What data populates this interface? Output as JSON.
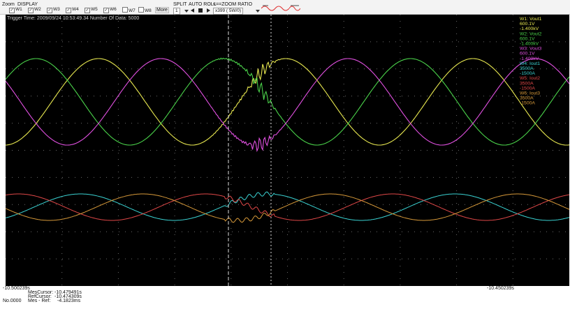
{
  "toolbar": {
    "zoom_label": "Zoom",
    "display_label": "DISPLAY",
    "split_label": "SPLIT",
    "auto_roll_label": "AUTO ROLL",
    "zoom_ratio_label": "<==ZOOM RATIO",
    "split_value": "1",
    "ratio_value": "x399 ( 5W/0)",
    "more_label": "More",
    "channels": [
      {
        "label": "W1",
        "checked": true
      },
      {
        "label": "W2",
        "checked": true
      },
      {
        "label": "W3",
        "checked": true
      },
      {
        "label": "W4",
        "checked": true
      },
      {
        "label": "W5",
        "checked": true
      },
      {
        "label": "W6",
        "checked": true
      },
      {
        "label": "W7",
        "checked": false
      },
      {
        "label": "W8",
        "checked": false
      }
    ]
  },
  "header": {
    "trigger_time_label": "Trigger Time:",
    "trigger_time_value": "2009/09/24  10:53:49.34",
    "number_of_data_label": "Number Of Data:",
    "number_of_data_value": "5000"
  },
  "legend": [
    {
      "name": "W1: Vout1",
      "max": "600.1V",
      "min": "-1.400kV",
      "color": "#e8e850"
    },
    {
      "name": "W2: Vout2",
      "max": "600.1V",
      "min": "-1.400kV",
      "color": "#4ad24a"
    },
    {
      "name": "W3: Vout3",
      "max": "600.1V",
      "min": "-1.400kV",
      "color": "#e050e0"
    },
    {
      "name": "W4: Iout1",
      "max": "3500A",
      "min": "-1500A",
      "color": "#3ad2d2"
    },
    {
      "name": "W5: Iout2",
      "max": "3500A",
      "min": "-1500A",
      "color": "#e04848"
    },
    {
      "name": "W6: Iout3",
      "max": "3500A",
      "min": "-1500A",
      "color": "#d89a3a"
    }
  ],
  "cursors": {
    "mes_cursor_label": "MesCursor:",
    "mes_cursor_value": "-10.479491s",
    "ref_cursor_label": "RefCursor:",
    "ref_cursor_value": "-10.474309s",
    "diff_label": "Mes - Ref:",
    "diff_value": "-4.1823ms",
    "record_number": "No.0000"
  },
  "time_axis": {
    "start": "-10.500239s",
    "end": "-10.450239s"
  },
  "colors": {
    "screen_bg": "#000000",
    "grid": "#6a6a6a",
    "cursor": "#dcdcdc"
  }
}
